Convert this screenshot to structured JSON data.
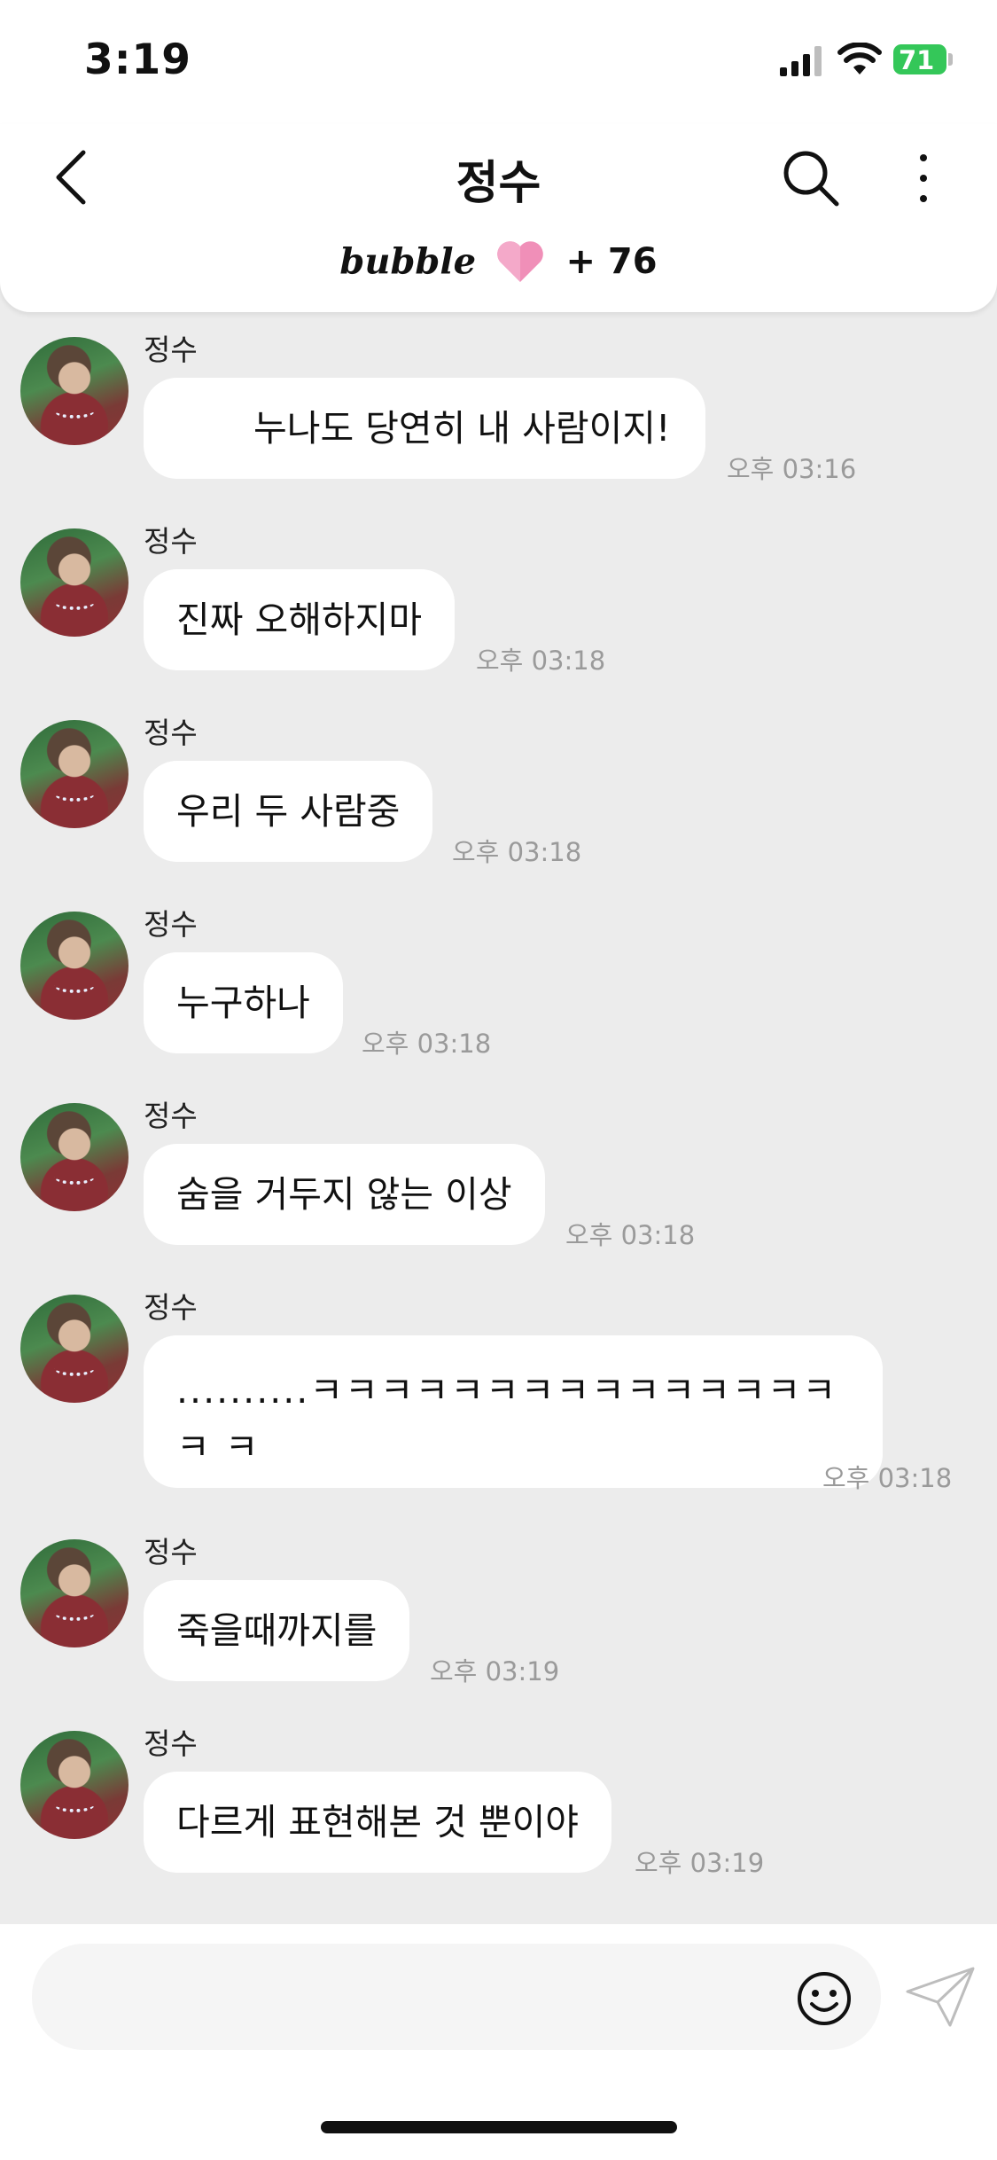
{
  "status": {
    "time": "3:19",
    "battery": "71"
  },
  "header": {
    "title": "정수",
    "brand": "bubble",
    "bubble_count": "+ 76"
  },
  "messages": [
    {
      "sender": "정수",
      "text": "누나도 당연히 내 사람이지!",
      "time": "오후 03:16"
    },
    {
      "sender": "정수",
      "text": "진짜 오해하지마",
      "time": "오후 03:18"
    },
    {
      "sender": "정수",
      "text": "우리 두 사람중",
      "time": "오후 03:18"
    },
    {
      "sender": "정수",
      "text": "누구하나",
      "time": "오후 03:18"
    },
    {
      "sender": "정수",
      "text": "숨을 거두지 않는 이상",
      "time": "오후 03:18"
    },
    {
      "sender": "정수",
      "text": "..........ㅋㅋㅋㅋㅋㅋㅋㅋㅋㅋㅋㅋㅋㅋㅋㅋ ㅋ",
      "time": "오후 03:18"
    },
    {
      "sender": "정수",
      "text": "죽을때까지를",
      "time": "오후 03:19"
    },
    {
      "sender": "정수",
      "text": "다르게 표현해본 것 뿐이야",
      "time": "오후 03:19"
    }
  ],
  "composer": {
    "placeholder": ""
  },
  "colors": {
    "battery": "#34c759",
    "background": "#ececec",
    "bubble": "#ffffff",
    "timestamp": "#9a9a9a"
  },
  "icons": [
    "back-arrow-icon",
    "search-icon",
    "more-vertical-icon",
    "heart-icon",
    "emoji-icon",
    "send-icon"
  ]
}
